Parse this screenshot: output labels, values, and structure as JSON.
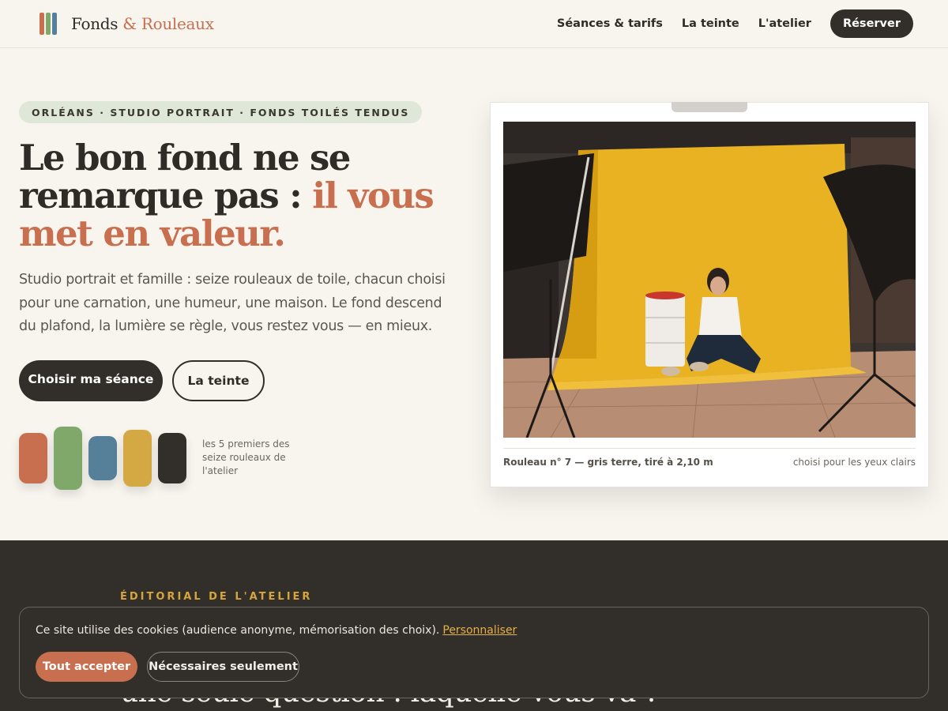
{
  "brand": {
    "name": "Fonds",
    "accent": "& Rouleaux",
    "logo_colors": [
      "#c86f50",
      "#7fa86a",
      "#56809a"
    ]
  },
  "nav": {
    "links": [
      "Séances & tarifs",
      "La teinte",
      "L'atelier"
    ],
    "cta": "Réserver"
  },
  "hero": {
    "eyebrow": "ORLÉANS · STUDIO PORTRAIT · FONDS TOILÉS TENDUS",
    "title_part1": "Le bon fond ne se remarque pas :",
    "title_part2": "il vous met en valeur.",
    "lead": "Studio portrait et famille : seize rouleaux de toile, chacun choisi pour une carnation, une humeur, une maison. Le fond descend du plafond, la lumière se règle, vous restez vous — en mieux.",
    "primary_button": "Choisir ma séance",
    "secondary_button": "La teinte",
    "rolls_caption": "les 5 premiers des seize rouleaux de l'atelier",
    "roll_colors": [
      "#c86f50",
      "#7fa86a",
      "#56809a",
      "#d4a843",
      "#322e2a"
    ]
  },
  "photo": {
    "caption": "Rouleau n° 7 — gris terre, tiré à 2,10 m",
    "note": "choisi pour les yeux clairs"
  },
  "editorial": {
    "eyebrow": "ÉDITORIAL DE L'ATELIER",
    "heading": "une seule question : laquelle vous va ?"
  },
  "cookie": {
    "text": "Ce site utilise des cookies (audience anonyme, mémorisation des choix).",
    "link": "Personnaliser",
    "accept": "Tout accepter",
    "necessary": "Nécessaires seulement"
  }
}
